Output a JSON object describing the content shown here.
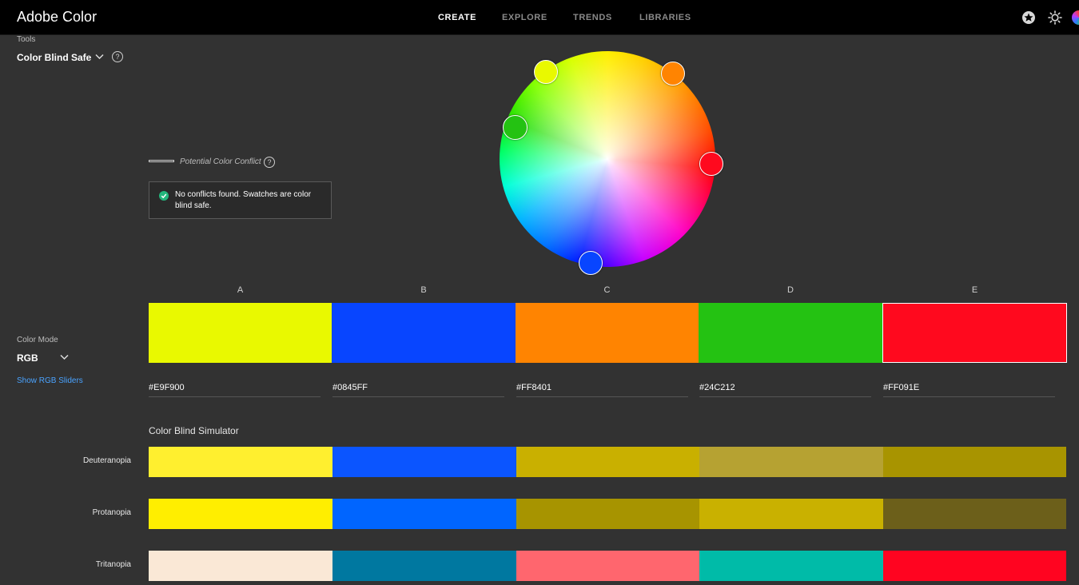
{
  "header": {
    "app_title": "Adobe Color",
    "nav": [
      {
        "label": "CREATE",
        "active": true
      },
      {
        "label": "EXPLORE",
        "active": false
      },
      {
        "label": "TRENDS",
        "active": false
      },
      {
        "label": "LIBRARIES",
        "active": false
      }
    ],
    "icons": [
      "star-badge-icon",
      "brightness-icon",
      "avatar-icon"
    ]
  },
  "tools": {
    "label": "Tools",
    "selected": "Color Blind Safe",
    "help": "?"
  },
  "conflict": {
    "legend_label": "Potential Color Conflict",
    "help": "?",
    "message": "No conflicts found. Swatches are color blind safe.",
    "status_color": "#23b67c"
  },
  "color_mode": {
    "label": "Color Mode",
    "selected": "RGB",
    "link": "Show RGB Sliders"
  },
  "swatches": [
    {
      "letter": "A",
      "hex": "#E9F900",
      "color": "#E9F900"
    },
    {
      "letter": "B",
      "hex": "#0845FF",
      "color": "#0845FF"
    },
    {
      "letter": "C",
      "hex": "#FF8401",
      "color": "#FF8401"
    },
    {
      "letter": "D",
      "hex": "#24C212",
      "color": "#24C212"
    },
    {
      "letter": "E",
      "hex": "#FF091E",
      "color": "#FF091E",
      "selected": true
    }
  ],
  "simulator": {
    "title": "Color Blind Simulator",
    "rows": [
      {
        "label": "Deuteranopia",
        "colors": [
          "#FFEF2F",
          "#0B55FF",
          "#C9B000",
          "#B6A232",
          "#A89400"
        ]
      },
      {
        "label": "Protanopia",
        "colors": [
          "#FFEE00",
          "#0065FF",
          "#A79400",
          "#C9B100",
          "#6C5F1A"
        ]
      },
      {
        "label": "Tritanopia",
        "colors": [
          "#FAE8D6",
          "#0078A0",
          "#FF666E",
          "#00BBA8",
          "#FF0420"
        ]
      }
    ]
  }
}
